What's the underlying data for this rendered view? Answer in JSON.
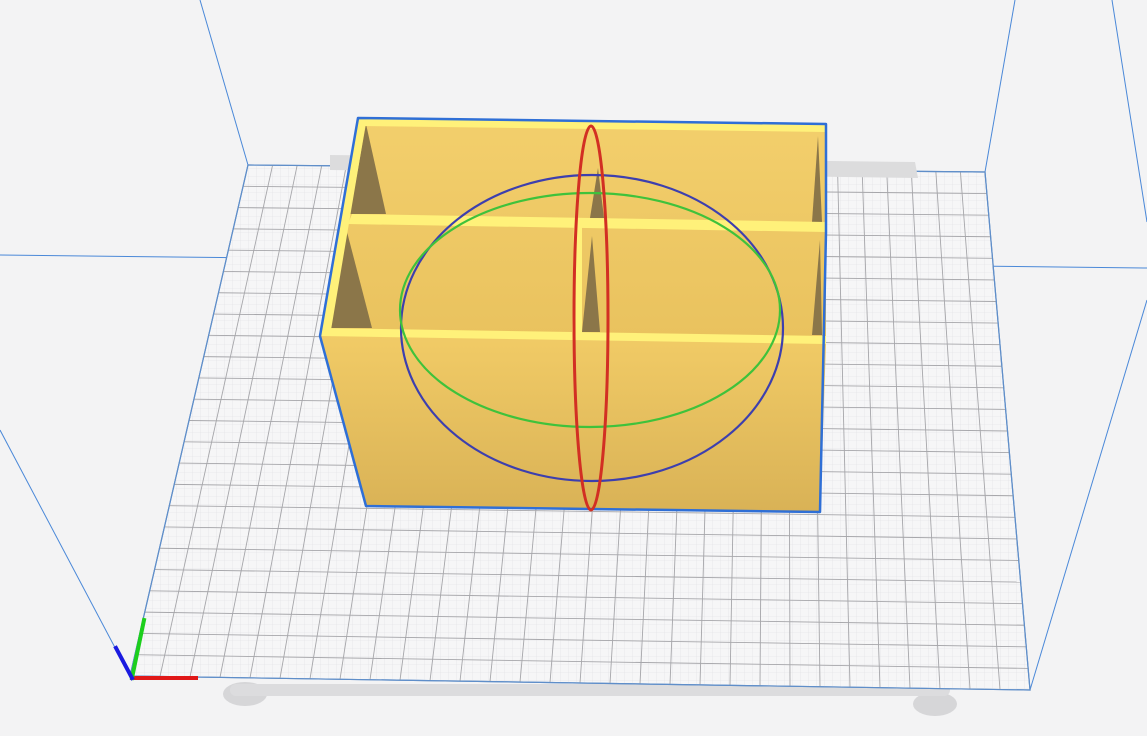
{
  "app": {
    "view": "3d-viewport"
  },
  "scene": {
    "background_color": "#f3f3f4",
    "build_plate": {
      "fill_color": "#f6f6f7",
      "minor_grid_color": "#d9d9db",
      "major_grid_color": "#a9a9ad",
      "edge_color": "#5f8ec9",
      "shadow_color": "#d7d7d8"
    },
    "build_volume_edge_color": "#4a88d8",
    "model": {
      "selected": true,
      "face_color": "#f2cd6a",
      "front_face_color": "#e8bf5a",
      "rim_color": "#fff17a",
      "shadow_color": "#8a7548",
      "outline_color": "#2f6fd6"
    },
    "rotate_tool": {
      "x_ring_color": "#d22f23",
      "y_ring_color": "#3fc23b",
      "z_ring_color": "#3d3fae"
    },
    "axis_gizmo": {
      "x_color": "#e01818",
      "y_color": "#1ccf1c",
      "z_color": "#1a1ae0"
    }
  }
}
